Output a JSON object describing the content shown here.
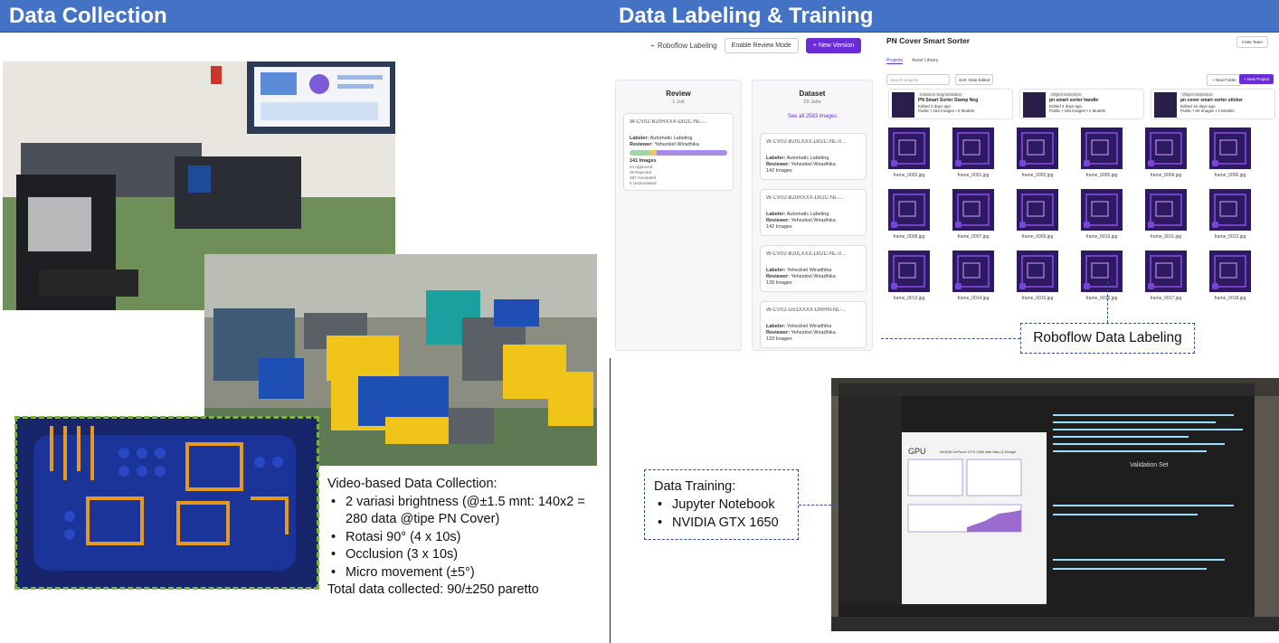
{
  "left": {
    "header": "Data Collection",
    "collection": {
      "intro": "Video-based Data Collection:",
      "items": [
        "2 variasi brightness (@±1.5 mnt: 140x2 = 280 data @tipe PN Cover)",
        "Rotasi 90° (4 x 10s)",
        "Occlusion (3 x 10s)",
        "Micro movement (±5°)"
      ],
      "total": "Total data collected: 90/±250 paretto"
    }
  },
  "right": {
    "header": "Data Labeling & Training",
    "roboflow": {
      "app_name": "Roboflow Labeling",
      "review_mode": "Enable Review Mode",
      "new_version": "+ New Version",
      "project_title": "PN Cover Smart Sorter",
      "invite": "Invite Team",
      "tabs": [
        "Projects",
        "Asset Library"
      ],
      "search_placeholder": "Search projects",
      "sort": "Sort: Date Edited",
      "new_folder": "+ New Folder",
      "new_project": "+ New Project",
      "review": {
        "title": "Review",
        "sub": "1 Job",
        "card": {
          "name": "W-CV02-B20RXXX-D02C-NL-...",
          "labeler_label": "Labeler:",
          "labeler": "Automatic Labeling",
          "reviewer_label": "Reviewer:",
          "reviewer": "Yehezkiel Wiradhika",
          "images": "141 Images",
          "stats": [
            "24 Approved",
            "28 Rejected",
            "387 Annotated",
            "0 Unannotated"
          ]
        }
      },
      "dataset": {
        "title": "Dataset",
        "sub": "29 Jobs",
        "see_all": "See all 2583 images",
        "cards": [
          {
            "name": "W-CV02-B20LXXX-D02C-NL-0...",
            "labeler": "Automatic Labeling",
            "reviewer": "Yehezkiel Wiradhika",
            "images": "142 Images"
          },
          {
            "name": "W-CV02-B20RXXX-D02C-NL-...",
            "labeler": "Automatic Labeling",
            "reviewer": "Yehezkiel Wiradhika",
            "images": "142 Images"
          },
          {
            "name": "W-CV02-B20LXXX-D02C-NL-0...",
            "labeler": "Yehezkiel Wiradhika",
            "reviewer": "Yehezkiel Wiradhika",
            "images": "139 Images"
          },
          {
            "name": "W-CV02-G51XXXX-DMHN-NL-...",
            "labeler": "Yehezkiel Wiradhika",
            "reviewer": "Yehezkiel Wiradhika",
            "images": "133 Images"
          }
        ],
        "labeler_label": "Labeler:",
        "reviewer_label": "Reviewer:"
      },
      "projects": [
        {
          "tag": "Instance Segmentation",
          "name": "PN Smart Sorter Stamp Neg",
          "edited": "Edited 3 days ago",
          "meta": "Public • 153 Images • 0 Models"
        },
        {
          "tag": "Object Detection",
          "name": "pn smart sorter handle",
          "edited": "Edited 4 days ago",
          "meta": "Public • 445 Images • 2 Models"
        },
        {
          "tag": "Object Detection",
          "name": "pn cover smart sorter sticker",
          "edited": "Edited 16 days ago",
          "meta": "Public • 60 Images • 2 Models"
        }
      ],
      "frames": [
        "frame_0003.jpg",
        "frame_0001.jpg",
        "frame_0002.jpg",
        "frame_0005.jpg",
        "frame_0004.jpg",
        "frame_0006.jpg",
        "frame_0008.jpg",
        "frame_0007.jpg",
        "frame_0009.jpg",
        "frame_0010.jpg",
        "frame_0011.jpg",
        "frame_0012.jpg",
        "frame_0013.jpg",
        "frame_0014.jpg",
        "frame_0015.jpg",
        "frame_0016.jpg",
        "frame_0017.jpg",
        "frame_0018.jpg"
      ]
    },
    "callout_labeling": "Roboflow Data Labeling",
    "training": {
      "title": "Data Training:",
      "items": [
        "Jupyter Notebook",
        "NVIDIA GTX 1650"
      ]
    },
    "laptop_screen": {
      "gpu_label": "GPU",
      "gpu_name": "NVIDIA GeForce GTX 1650 with Max-Q Design",
      "section": "Validation Set"
    }
  }
}
